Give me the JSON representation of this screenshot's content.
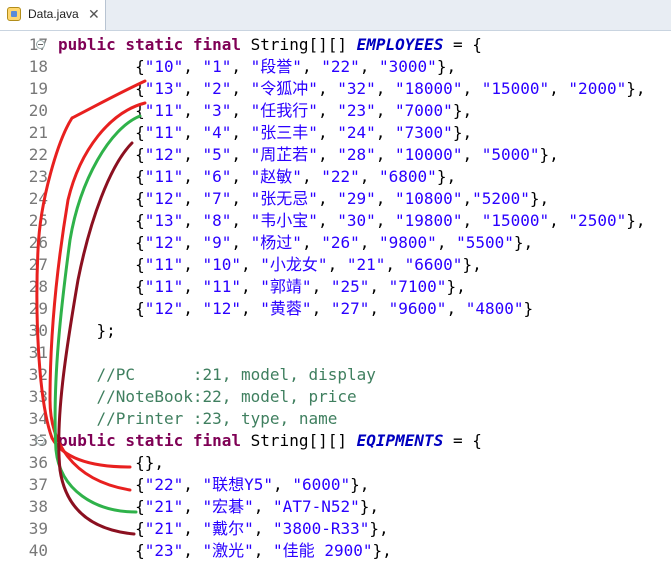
{
  "tab": {
    "label": "Data.java",
    "close_glyph": "✕"
  },
  "lines": [
    {
      "num": "17",
      "fold": true,
      "tokens": [
        [
          "kw",
          "public static final "
        ],
        [
          "plain",
          "String[][] "
        ],
        [
          "fld",
          "EMPLOYEES"
        ],
        [
          "plain",
          " = {"
        ]
      ]
    },
    {
      "num": "18",
      "tokens": [
        [
          "plain",
          "        {"
        ],
        [
          "str",
          "\"10\""
        ],
        [
          "plain",
          ", "
        ],
        [
          "str",
          "\"1\""
        ],
        [
          "plain",
          ", "
        ],
        [
          "str",
          "\"段誉\""
        ],
        [
          "plain",
          ", "
        ],
        [
          "str",
          "\"22\""
        ],
        [
          "plain",
          ", "
        ],
        [
          "str",
          "\"3000\""
        ],
        [
          "plain",
          "},"
        ]
      ]
    },
    {
      "num": "19",
      "tokens": [
        [
          "plain",
          "        {"
        ],
        [
          "str",
          "\"13\""
        ],
        [
          "plain",
          ", "
        ],
        [
          "str",
          "\"2\""
        ],
        [
          "plain",
          ", "
        ],
        [
          "str",
          "\"令狐冲\""
        ],
        [
          "plain",
          ", "
        ],
        [
          "str",
          "\"32\""
        ],
        [
          "plain",
          ", "
        ],
        [
          "str",
          "\"18000\""
        ],
        [
          "plain",
          ", "
        ],
        [
          "str",
          "\"15000\""
        ],
        [
          "plain",
          ", "
        ],
        [
          "str",
          "\"2000\""
        ],
        [
          "plain",
          "},"
        ]
      ]
    },
    {
      "num": "20",
      "tokens": [
        [
          "plain",
          "        {"
        ],
        [
          "str",
          "\"11\""
        ],
        [
          "plain",
          ", "
        ],
        [
          "str",
          "\"3\""
        ],
        [
          "plain",
          ", "
        ],
        [
          "str",
          "\"任我行\""
        ],
        [
          "plain",
          ", "
        ],
        [
          "str",
          "\"23\""
        ],
        [
          "plain",
          ", "
        ],
        [
          "str",
          "\"7000\""
        ],
        [
          "plain",
          "},"
        ]
      ]
    },
    {
      "num": "21",
      "tokens": [
        [
          "plain",
          "        {"
        ],
        [
          "str",
          "\"11\""
        ],
        [
          "plain",
          ", "
        ],
        [
          "str",
          "\"4\""
        ],
        [
          "plain",
          ", "
        ],
        [
          "str",
          "\"张三丰\""
        ],
        [
          "plain",
          ", "
        ],
        [
          "str",
          "\"24\""
        ],
        [
          "plain",
          ", "
        ],
        [
          "str",
          "\"7300\""
        ],
        [
          "plain",
          "},"
        ]
      ]
    },
    {
      "num": "22",
      "tokens": [
        [
          "plain",
          "        {"
        ],
        [
          "str",
          "\"12\""
        ],
        [
          "plain",
          ", "
        ],
        [
          "str",
          "\"5\""
        ],
        [
          "plain",
          ", "
        ],
        [
          "str",
          "\"周芷若\""
        ],
        [
          "plain",
          ", "
        ],
        [
          "str",
          "\"28\""
        ],
        [
          "plain",
          ", "
        ],
        [
          "str",
          "\"10000\""
        ],
        [
          "plain",
          ", "
        ],
        [
          "str",
          "\"5000\""
        ],
        [
          "plain",
          "},"
        ]
      ]
    },
    {
      "num": "23",
      "tokens": [
        [
          "plain",
          "        {"
        ],
        [
          "str",
          "\"11\""
        ],
        [
          "plain",
          ", "
        ],
        [
          "str",
          "\"6\""
        ],
        [
          "plain",
          ", "
        ],
        [
          "str",
          "\"赵敏\""
        ],
        [
          "plain",
          ", "
        ],
        [
          "str",
          "\"22\""
        ],
        [
          "plain",
          ", "
        ],
        [
          "str",
          "\"6800\""
        ],
        [
          "plain",
          "},"
        ]
      ]
    },
    {
      "num": "24",
      "tokens": [
        [
          "plain",
          "        {"
        ],
        [
          "str",
          "\"12\""
        ],
        [
          "plain",
          ", "
        ],
        [
          "str",
          "\"7\""
        ],
        [
          "plain",
          ", "
        ],
        [
          "str",
          "\"张无忌\""
        ],
        [
          "plain",
          ", "
        ],
        [
          "str",
          "\"29\""
        ],
        [
          "plain",
          ", "
        ],
        [
          "str",
          "\"10800\""
        ],
        [
          "plain",
          ","
        ],
        [
          "str",
          "\"5200\""
        ],
        [
          "plain",
          "},"
        ]
      ]
    },
    {
      "num": "25",
      "tokens": [
        [
          "plain",
          "        {"
        ],
        [
          "str",
          "\"13\""
        ],
        [
          "plain",
          ", "
        ],
        [
          "str",
          "\"8\""
        ],
        [
          "plain",
          ", "
        ],
        [
          "str",
          "\"韦小宝\""
        ],
        [
          "plain",
          ", "
        ],
        [
          "str",
          "\"30\""
        ],
        [
          "plain",
          ", "
        ],
        [
          "str",
          "\"19800\""
        ],
        [
          "plain",
          ", "
        ],
        [
          "str",
          "\"15000\""
        ],
        [
          "plain",
          ", "
        ],
        [
          "str",
          "\"2500\""
        ],
        [
          "plain",
          "},"
        ]
      ]
    },
    {
      "num": "26",
      "tokens": [
        [
          "plain",
          "        {"
        ],
        [
          "str",
          "\"12\""
        ],
        [
          "plain",
          ", "
        ],
        [
          "str",
          "\"9\""
        ],
        [
          "plain",
          ", "
        ],
        [
          "str",
          "\"杨过\""
        ],
        [
          "plain",
          ", "
        ],
        [
          "str",
          "\"26\""
        ],
        [
          "plain",
          ", "
        ],
        [
          "str",
          "\"9800\""
        ],
        [
          "plain",
          ", "
        ],
        [
          "str",
          "\"5500\""
        ],
        [
          "plain",
          "},"
        ]
      ]
    },
    {
      "num": "27",
      "tokens": [
        [
          "plain",
          "        {"
        ],
        [
          "str",
          "\"11\""
        ],
        [
          "plain",
          ", "
        ],
        [
          "str",
          "\"10\""
        ],
        [
          "plain",
          ", "
        ],
        [
          "str",
          "\"小龙女\""
        ],
        [
          "plain",
          ", "
        ],
        [
          "str",
          "\"21\""
        ],
        [
          "plain",
          ", "
        ],
        [
          "str",
          "\"6600\""
        ],
        [
          "plain",
          "},"
        ]
      ]
    },
    {
      "num": "28",
      "tokens": [
        [
          "plain",
          "        {"
        ],
        [
          "str",
          "\"11\""
        ],
        [
          "plain",
          ", "
        ],
        [
          "str",
          "\"11\""
        ],
        [
          "plain",
          ", "
        ],
        [
          "str",
          "\"郭靖\""
        ],
        [
          "plain",
          ", "
        ],
        [
          "str",
          "\"25\""
        ],
        [
          "plain",
          ", "
        ],
        [
          "str",
          "\"7100\""
        ],
        [
          "plain",
          "},"
        ]
      ]
    },
    {
      "num": "29",
      "tokens": [
        [
          "plain",
          "        {"
        ],
        [
          "str",
          "\"12\""
        ],
        [
          "plain",
          ", "
        ],
        [
          "str",
          "\"12\""
        ],
        [
          "plain",
          ", "
        ],
        [
          "str",
          "\"黄蓉\""
        ],
        [
          "plain",
          ", "
        ],
        [
          "str",
          "\"27\""
        ],
        [
          "plain",
          ", "
        ],
        [
          "str",
          "\"9600\""
        ],
        [
          "plain",
          ", "
        ],
        [
          "str",
          "\"4800\""
        ],
        [
          "plain",
          "}"
        ]
      ]
    },
    {
      "num": "30",
      "tokens": [
        [
          "plain",
          "    };"
        ]
      ]
    },
    {
      "num": "31",
      "tokens": []
    },
    {
      "num": "32",
      "tokens": [
        [
          "cmt",
          "    //PC      :21, model, display"
        ]
      ]
    },
    {
      "num": "33",
      "tokens": [
        [
          "cmt",
          "    //NoteBook:22, model, price"
        ]
      ]
    },
    {
      "num": "34",
      "tokens": [
        [
          "cmt",
          "    //Printer :23, type, name"
        ]
      ]
    },
    {
      "num": "35",
      "fold": true,
      "tokens": [
        [
          "kw",
          "public static final "
        ],
        [
          "plain",
          "String[][] "
        ],
        [
          "fld",
          "EQIPMENTS"
        ],
        [
          "plain",
          " = {"
        ]
      ]
    },
    {
      "num": "36",
      "tokens": [
        [
          "plain",
          "        {},"
        ]
      ]
    },
    {
      "num": "37",
      "tokens": [
        [
          "plain",
          "        {"
        ],
        [
          "str",
          "\"22\""
        ],
        [
          "plain",
          ", "
        ],
        [
          "str",
          "\"联想Y5\""
        ],
        [
          "plain",
          ", "
        ],
        [
          "str",
          "\"6000\""
        ],
        [
          "plain",
          "},"
        ]
      ]
    },
    {
      "num": "38",
      "tokens": [
        [
          "plain",
          "        {"
        ],
        [
          "str",
          "\"21\""
        ],
        [
          "plain",
          ", "
        ],
        [
          "str",
          "\"宏碁\""
        ],
        [
          "plain",
          ", "
        ],
        [
          "str",
          "\"AT7-N52\""
        ],
        [
          "plain",
          "},"
        ]
      ]
    },
    {
      "num": "39",
      "tokens": [
        [
          "plain",
          "        {"
        ],
        [
          "str",
          "\"21\""
        ],
        [
          "plain",
          ", "
        ],
        [
          "str",
          "\"戴尔\""
        ],
        [
          "plain",
          ", "
        ],
        [
          "str",
          "\"3800-R33\""
        ],
        [
          "plain",
          "},"
        ]
      ]
    },
    {
      "num": "40",
      "tokens": [
        [
          "plain",
          "        {"
        ],
        [
          "str",
          "\"23\""
        ],
        [
          "plain",
          ", "
        ],
        [
          "str",
          "\"激光\""
        ],
        [
          "plain",
          ", "
        ],
        [
          "str",
          "\"佳能 2900\""
        ],
        [
          "plain",
          "},"
        ]
      ]
    }
  ],
  "annotations": [
    {
      "color": "#e8201f"
    },
    {
      "color": "#e8201f"
    },
    {
      "color": "#2fb24a"
    },
    {
      "color": "#8b1020"
    }
  ]
}
